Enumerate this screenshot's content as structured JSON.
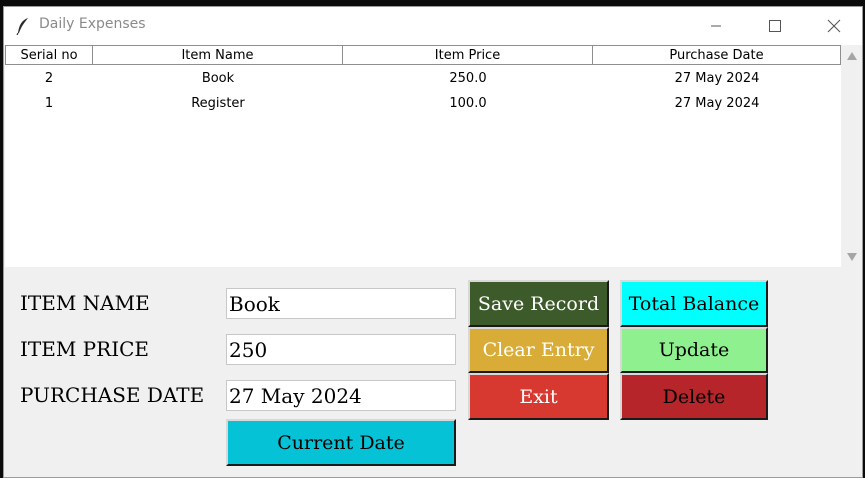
{
  "window": {
    "title": "Daily Expenses"
  },
  "table": {
    "columns": [
      "Serial no",
      "Item Name",
      "Item Price",
      "Purchase Date"
    ],
    "rows": [
      [
        "2",
        "Book",
        "250.0",
        "27 May 2024"
      ],
      [
        "1",
        "Register",
        "100.0",
        "27 May 2024"
      ]
    ]
  },
  "form": {
    "item_name_label": "ITEM NAME",
    "item_price_label": "ITEM PRICE",
    "purchase_date_label": "PURCHASE DATE",
    "item_name_value": "Book",
    "item_price_value": "250",
    "purchase_date_value": "27 May 2024",
    "current_date_label": "Current Date"
  },
  "buttons": {
    "save_record": "Save Record",
    "total_balance": "Total Balance",
    "clear_entry": "Clear Entry",
    "update": "Update",
    "exit": "Exit",
    "delete": "Delete"
  },
  "colors": {
    "save_record": "#3d5a2b",
    "total_balance": "#00ffff",
    "clear_entry": "#d8ac37",
    "update": "#8ff08f",
    "exit": "#d7382f",
    "delete": "#b5252a",
    "current_date": "#06c2d6"
  },
  "icons": {
    "app": "feather-icon",
    "minimize": "minimize-icon",
    "maximize": "maximize-icon",
    "close": "close-icon"
  }
}
